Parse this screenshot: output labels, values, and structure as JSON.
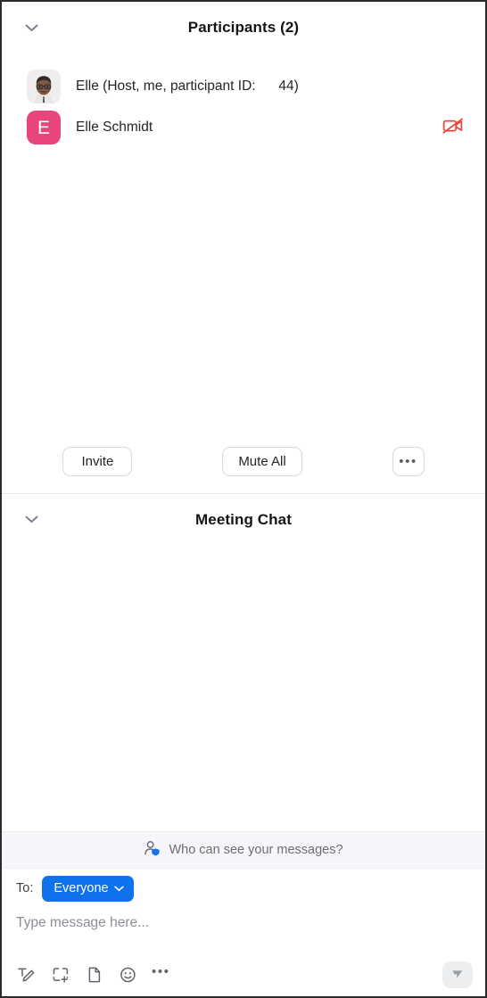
{
  "participants_panel": {
    "title": "Participants (2)",
    "collapse_icon": "chevron-down-icon",
    "participants": [
      {
        "name": "Elle (Host, me, participant ID:      44)",
        "avatar_type": "photo",
        "avatar_initial": "",
        "video_off": false
      },
      {
        "name": "Elle Schmidt",
        "avatar_type": "initial",
        "avatar_initial": "E",
        "avatar_color": "#e8447e",
        "video_off": true,
        "video_off_icon": "video-off-icon",
        "video_off_color": "#e8443a"
      }
    ],
    "actions": {
      "invite_label": "Invite",
      "mute_all_label": "Mute All",
      "more_label": "•••",
      "more_icon": "ellipsis-icon"
    }
  },
  "chat_panel": {
    "title": "Meeting Chat",
    "collapse_icon": "chevron-down-icon",
    "messages": [],
    "privacy_bar": {
      "icon": "person-shield-icon",
      "text": "Who can see your messages?",
      "shield_color": "#1a73e8"
    },
    "compose": {
      "to_label": "To:",
      "recipient": "Everyone",
      "recipient_chevron": "chevron-down-icon",
      "recipient_color": "#0e72ed",
      "placeholder": "Type message here...",
      "value": "",
      "toolbar": [
        {
          "icon": "format-text-icon",
          "label": "Format"
        },
        {
          "icon": "screenshot-icon",
          "label": "Screenshot"
        },
        {
          "icon": "file-icon",
          "label": "File"
        },
        {
          "icon": "emoji-icon",
          "label": "Emoji"
        },
        {
          "icon": "ellipsis-icon",
          "label": "•••"
        }
      ],
      "send_icon": "send-icon"
    }
  }
}
